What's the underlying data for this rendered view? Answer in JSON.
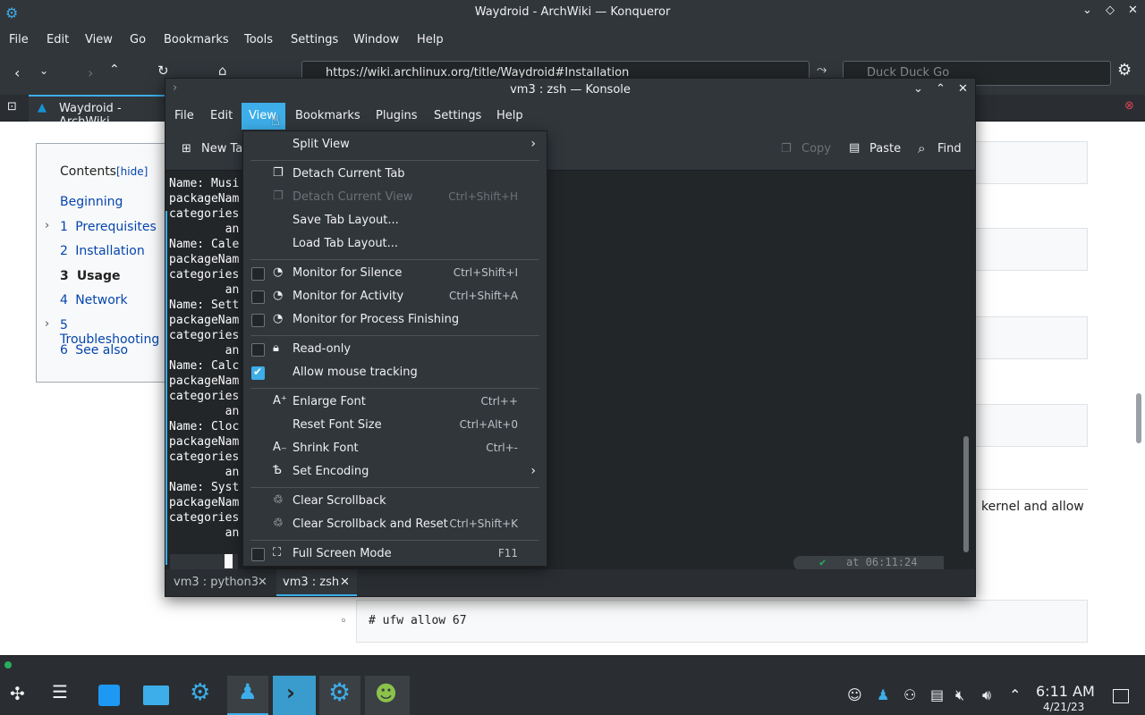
{
  "browser": {
    "title": "Waydroid - ArchWiki — Konqueror",
    "menu": [
      "File",
      "Edit",
      "View",
      "Go",
      "Bookmarks",
      "Tools",
      "Settings",
      "Window",
      "Help"
    ],
    "url": "https://wiki.archlinux.org/title/Waydroid#Installation",
    "search_placeholder": "Duck Duck Go",
    "tab_label": "Waydroid - ArchWiki"
  },
  "toc": {
    "title": "Contents",
    "hide_label": "[hide]",
    "items": [
      {
        "num": "",
        "label": "Beginning"
      },
      {
        "num": "1",
        "label": "Prerequisites"
      },
      {
        "num": "2",
        "label": "Installation"
      },
      {
        "num": "3",
        "label": "Usage"
      },
      {
        "num": "4",
        "label": "Network"
      },
      {
        "num": "5",
        "label": "Troubleshooting"
      },
      {
        "num": "6",
        "label": "See also"
      }
    ]
  },
  "page": {
    "fragment_text": "kernel and allow",
    "code_line": "# ufw allow 67"
  },
  "konsole": {
    "title": "vm3 : zsh — Konsole",
    "menu": [
      "File",
      "Edit",
      "View",
      "Bookmarks",
      "Plugins",
      "Settings",
      "Help"
    ],
    "toolbar": {
      "new_tab": "New Ta",
      "copy": "Copy",
      "paste": "Paste",
      "find": "Find"
    },
    "terminal_lines": [
      "Name: Musi",
      "packageNam",
      "categories",
      "        an",
      "Name: Cale",
      "packageNam",
      "categories",
      "        an",
      "Name: Sett",
      "packageNam",
      "categories",
      "        an",
      "Name: Calc",
      "packageNam",
      "categories",
      "        an",
      "Name: Cloc",
      "packageNam",
      "categories",
      "        an",
      "Name: Syst",
      "packageNam",
      "categories",
      "        an"
    ],
    "prompt_time": "at 06:11:24",
    "tabs": [
      "vm3 : python3",
      "vm3 : zsh"
    ]
  },
  "view_menu": {
    "items": [
      {
        "label": "Split View",
        "shortcut": "",
        "submenu": true
      },
      {
        "label": "Detach Current Tab",
        "shortcut": ""
      },
      {
        "label": "Detach Current View",
        "shortcut": "Ctrl+Shift+H",
        "disabled": true
      },
      {
        "label": "Save Tab Layout...",
        "shortcut": ""
      },
      {
        "label": "Load Tab Layout...",
        "shortcut": ""
      },
      {
        "label": "Monitor for Silence",
        "shortcut": "Ctrl+Shift+I",
        "checked": false
      },
      {
        "label": "Monitor for Activity",
        "shortcut": "Ctrl+Shift+A",
        "checked": false
      },
      {
        "label": "Monitor for Process Finishing",
        "shortcut": "",
        "checked": false
      },
      {
        "label": "Read-only",
        "shortcut": "",
        "checked": false
      },
      {
        "label": "Allow mouse tracking",
        "shortcut": "",
        "checked": true
      },
      {
        "label": "Enlarge Font",
        "shortcut": "Ctrl++"
      },
      {
        "label": "Reset Font Size",
        "shortcut": "Ctrl+Alt+0"
      },
      {
        "label": "Shrink Font",
        "shortcut": "Ctrl+-"
      },
      {
        "label": "Set Encoding",
        "shortcut": "",
        "submenu": true
      },
      {
        "label": "Clear Scrollback",
        "shortcut": ""
      },
      {
        "label": "Clear Scrollback and Reset",
        "shortcut": "Ctrl+Shift+K"
      },
      {
        "label": "Full Screen Mode",
        "shortcut": "F11",
        "checked": false
      }
    ]
  },
  "taskbar": {
    "time": "6:11 AM",
    "date": "4/21/23"
  },
  "colors": {
    "accent": "#3daee9",
    "panel": "#31363b",
    "terminal_bg": "#232629"
  }
}
